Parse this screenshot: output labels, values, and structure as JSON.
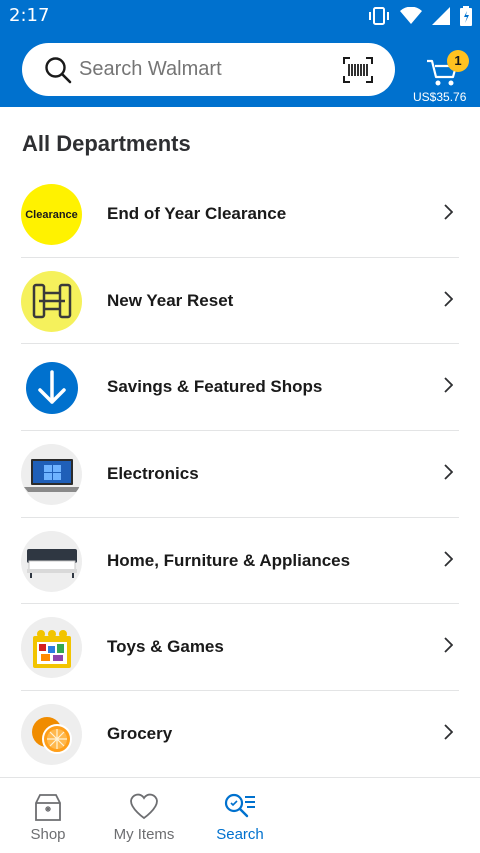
{
  "status_bar": {
    "time": "2:17"
  },
  "header": {
    "search_placeholder": "Search Walmart",
    "cart_count": "1",
    "cart_total": "US$35.76"
  },
  "page_title": "All Departments",
  "departments": [
    {
      "label": "End of Year Clearance",
      "thumb_text": "Clearance"
    },
    {
      "label": "New Year Reset"
    },
    {
      "label": "Savings & Featured Shops"
    },
    {
      "label": "Electronics"
    },
    {
      "label": "Home, Furniture & Appliances"
    },
    {
      "label": "Toys & Games"
    },
    {
      "label": "Grocery"
    }
  ],
  "bottom_nav": [
    {
      "label": "Shop",
      "icon": "shop-icon"
    },
    {
      "label": "My Items",
      "icon": "heart-icon"
    },
    {
      "label": "Search",
      "icon": "search-list-icon"
    }
  ],
  "colors": {
    "brand_blue": "#0071ce",
    "cart_badge": "#ffc220",
    "clearance_yellow": "#fff200"
  }
}
